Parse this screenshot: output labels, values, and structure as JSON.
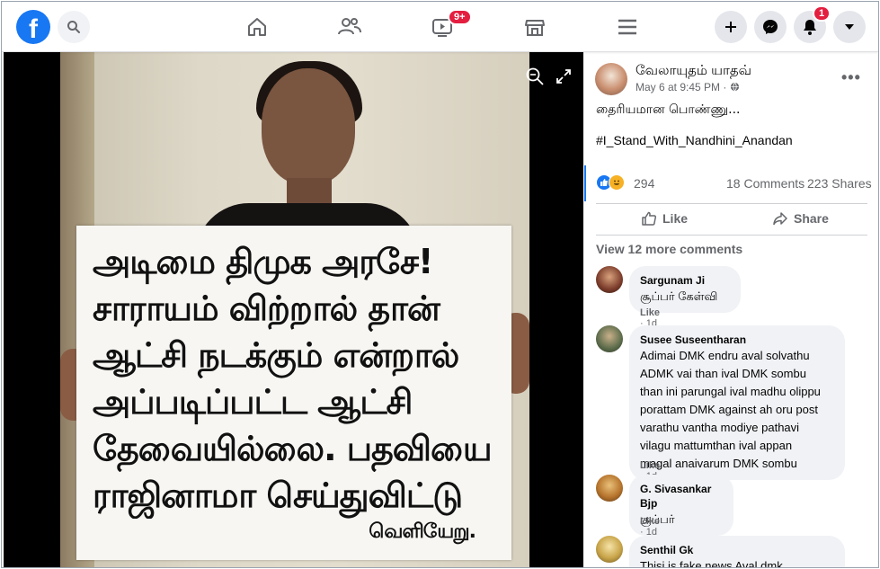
{
  "topbar": {
    "logo": "f",
    "watch_badge": "9+",
    "notifications_badge": "1"
  },
  "photo": {
    "placard_lines": [
      "அடிமை   திமுக அரசே!",
      "சாராயம் விற்றால் தான்",
      "ஆட்சி நடக்கும் என்றால்",
      "அப்படிப்பட்ட ஆட்சி",
      "தேவையில்லை. பதவியை",
      "ராஜினாமா செய்துவிட்டு"
    ],
    "placard_last": "வெளியேறு."
  },
  "post": {
    "author": "வேலாயுதம் யாதவ்",
    "time": "May 6 at 9:45 PM · ",
    "text": "தைரியமான பொண்ணு...",
    "hashtag": "#I_Stand_With_Nandhini_Anandan",
    "reactions": "294",
    "comments": "18 Comments",
    "shares": "223 Shares",
    "like_label": "Like",
    "share_label": "Share",
    "view_more": "View 12 more comments"
  },
  "comments": [
    {
      "name": "Sargunam Ji",
      "lines": [
        "சூப்பர் கேள்வி"
      ],
      "like": "Like",
      "time": " · 1d",
      "avatar_color": "#7a3b2a"
    },
    {
      "name": "Susee Suseentharan",
      "lines": [
        "Adimai DMK endru aval solvathu",
        "ADMK vai than ival DMK sombu",
        "than ini parungal ival madhu olippu",
        "porattam DMK against ah oru post",
        "varathu vantha modiye pathavi",
        "vilagu mattumthan ival appan",
        "magal anaivarum DMK sombu"
      ],
      "like": "Like",
      "time": " · 1d",
      "avatar_color": "#5b6b4a"
    },
    {
      "name": "G. Sivasankar Bjp",
      "lines": [
        "சூப்பர்"
      ],
      "like": "Like",
      "time": " · 1d",
      "avatar_color": "#b8762e"
    },
    {
      "name": "Senthil Gk",
      "lines": [
        "Thisi is fake news Aval dmk"
      ],
      "like": "",
      "time": "",
      "avatar_color": "#c9a54a"
    }
  ]
}
